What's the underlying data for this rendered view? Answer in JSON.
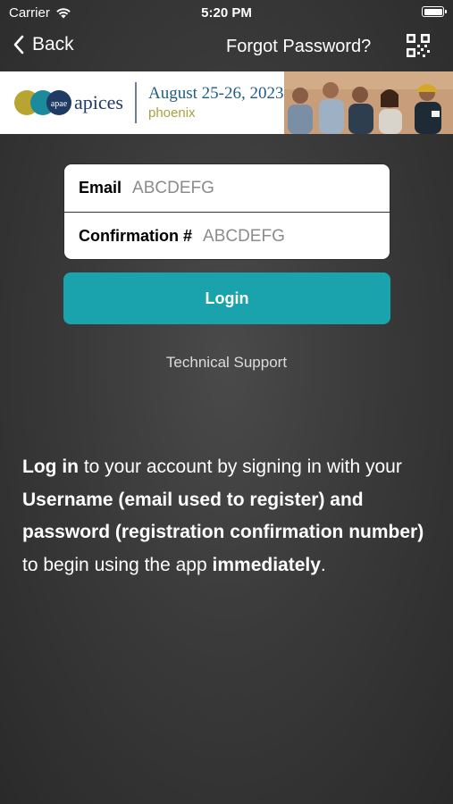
{
  "status_bar": {
    "carrier": "Carrier",
    "time": "5:20 PM"
  },
  "nav": {
    "back_label": "Back",
    "forgot_label": "Forgot Password?",
    "qr_icon": "qr-code-icon"
  },
  "banner": {
    "brand": "apices",
    "logo_letters": "apae",
    "date": "August 25-26, 2023",
    "city": "phoenix",
    "colors": {
      "navy": "#1f3a63",
      "teal": "#1b8a9a",
      "gold": "#b8a431"
    }
  },
  "form": {
    "email_label": "Email",
    "email_value": "ABCDEFG",
    "confirmation_label": "Confirmation #",
    "confirmation_value": "ABCDEFG"
  },
  "login_label": "Login",
  "tech_support_label": "Technical Support",
  "intro": {
    "p1": "Log in",
    "p2": " to your account by signing in with your ",
    "p3": "Username (email used to register) and password (registration confirmation number)",
    "p4": " to begin using the app ",
    "p5": "immediately",
    "p6": "."
  },
  "colors": {
    "accent": "#1aa3ad",
    "background": "#3a3a3a"
  }
}
